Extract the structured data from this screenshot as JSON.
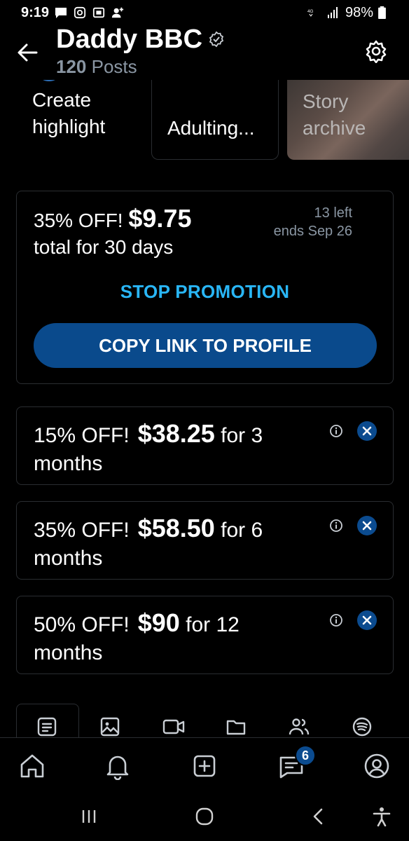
{
  "status_bar": {
    "time": "9:19",
    "battery": "98%"
  },
  "header": {
    "title": "Daddy BBC",
    "posts_count": "120",
    "posts_label": "Posts"
  },
  "highlights": [
    {
      "label_line1": "Create",
      "label_line2": "highlight"
    },
    {
      "label": "Adulting..."
    },
    {
      "label_line1": "Story",
      "label_line2": "archive"
    }
  ],
  "promotion": {
    "discount": "35% OFF!",
    "price": "$9.75",
    "duration": "total for 30 days",
    "left": "13 left",
    "ends": "ends Sep 26",
    "stop_label": "STOP PROMOTION",
    "copy_label": "COPY LINK TO PROFILE"
  },
  "bundles": [
    {
      "discount": "15% OFF!",
      "price": "$38.25",
      "for": "for 3",
      "unit": "months"
    },
    {
      "discount": "35% OFF!",
      "price": "$58.50",
      "for": "for 6",
      "unit": "months"
    },
    {
      "discount": "50% OFF!",
      "price": "$90",
      "for": "for 12",
      "unit": "months"
    }
  ],
  "tabs": [
    "posts-tab",
    "photos-tab",
    "videos-tab",
    "folders-tab",
    "fans-tab",
    "spotify-tab"
  ],
  "bottom_nav": {
    "messages_badge": "6"
  },
  "colors": {
    "accent": "#29b6f6",
    "button": "#0a4a8c",
    "muted": "#8a96a3",
    "border": "#2a2d31"
  }
}
